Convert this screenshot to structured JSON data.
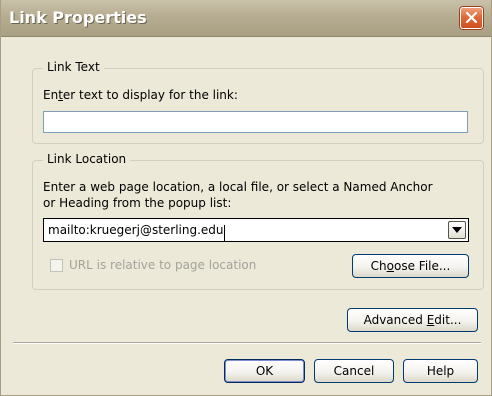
{
  "window": {
    "title": "Link Properties",
    "close_label": "close"
  },
  "link_text": {
    "legend": "Link Text",
    "prompt_before": "En",
    "prompt_mnemonic": "t",
    "prompt_after": "er text to display for the link:",
    "value": ""
  },
  "link_location": {
    "legend": "Link Location",
    "description_line1": "Enter a web page location, a local file, or select a Named Anchor",
    "description_line2": "or Heading from the popup list:",
    "url_value": "mailto:kruegerj@sterling.edu",
    "relative_checkbox_label": "URL is relative to page location",
    "relative_checked": false,
    "choose_file_before": "Ch",
    "choose_file_mnemonic": "o",
    "choose_file_after": "ose File..."
  },
  "advanced_edit": {
    "before": "Advanced ",
    "mnemonic": "E",
    "after": "dit..."
  },
  "buttons": {
    "ok": "OK",
    "cancel": "Cancel",
    "help": "Help"
  },
  "icons": {
    "close": "close-x-icon",
    "dropdown": "chevron-down-icon"
  },
  "colors": {
    "close_button": "#E06A3A",
    "dialog_background": "#ECE9D8",
    "titlebar": "#B6AD92"
  }
}
